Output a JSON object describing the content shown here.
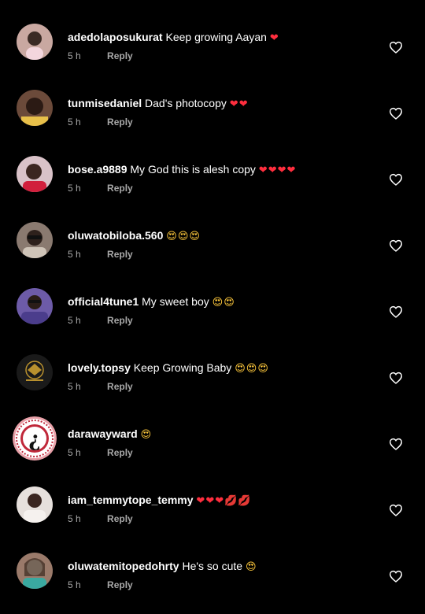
{
  "comments": [
    {
      "username": "adedolaposukurat",
      "text": "Keep growing Aayan",
      "emoji": "❤",
      "time": "5 h",
      "reply": "Reply",
      "avatar_color": "#c9a8a1"
    },
    {
      "username": "tunmisedaniel",
      "text": "Dad's photocopy",
      "emoji": "❤❤",
      "time": "5 h",
      "reply": "Reply",
      "avatar_color": "#6b4a3a"
    },
    {
      "username": "bose.a9889",
      "text": "My God this is alesh copy",
      "emoji": "❤❤❤❤",
      "time": "5 h",
      "reply": "Reply",
      "avatar_color": "#d9c2c8"
    },
    {
      "username": "oluwatobiloba.560",
      "text": "",
      "emoji": "😍😍😍",
      "time": "5 h",
      "reply": "Reply",
      "avatar_color": "#8a7a70"
    },
    {
      "username": "official4tune1",
      "text": "My sweet boy",
      "emoji": "😍😍",
      "time": "5 h",
      "reply": "Reply",
      "avatar_color": "#6d5ba8"
    },
    {
      "username": "lovely.topsy",
      "text": "Keep Growing Baby",
      "emoji": "😍😍😍",
      "time": "5 h",
      "reply": "Reply",
      "avatar_color": "#1a1a1a"
    },
    {
      "username": "darawayward",
      "text": "",
      "emoji": "😍",
      "time": "5 h",
      "reply": "Reply",
      "avatar_color": "#e8a0a8"
    },
    {
      "username": "iam_temmytope_temmy",
      "text": "",
      "emoji": "❤❤❤💋💋",
      "time": "5 h",
      "reply": "Reply",
      "avatar_color": "#e6e0dc"
    },
    {
      "username": "oluwatemitopedohrty",
      "text": "He's so cute",
      "emoji": "😍",
      "time": "5 h",
      "reply": "Reply",
      "avatar_color": "#9a7a6a"
    }
  ],
  "colors": {
    "background": "#000000",
    "meta": "#a8a8a8",
    "heart": "#ff2e3e"
  },
  "icons": {
    "like": "heart-outline-icon"
  }
}
